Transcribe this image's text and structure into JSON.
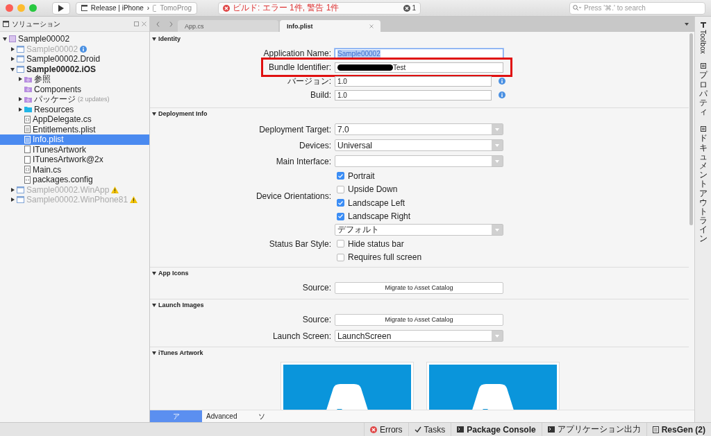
{
  "toolbar": {
    "config": "Release | iPhone",
    "separator": "›",
    "device": "TomoProg",
    "status": "ビルド: エラー 1件, 警告 1件",
    "error_count": "1",
    "search": {
      "placeholder": "Press '⌘.' to search"
    }
  },
  "solution_pad": {
    "title": "ソリューション",
    "tree": [
      {
        "label": "Sample00002",
        "kind": "solution",
        "expanded": true,
        "dimmed": false,
        "selected": false,
        "children": [
          {
            "label": "Sample00002",
            "kind": "project",
            "expanded": false,
            "dimmed": true,
            "selected": false,
            "info": true,
            "warning": false
          },
          {
            "label": "Sample00002.Droid",
            "kind": "project",
            "expanded": false,
            "dimmed": false,
            "selected": false,
            "info": false,
            "warning": false
          },
          {
            "label": "Sample00002.iOS",
            "kind": "project",
            "expanded": true,
            "dimmed": false,
            "selected": false,
            "bold": true,
            "info": false,
            "warning": false,
            "children": [
              {
                "label": "参照",
                "kind": "special-folder",
                "expanded": false,
                "dimmed": false,
                "selected": false
              },
              {
                "label": "Components",
                "kind": "special-folder",
                "dimmed": false,
                "selected": false
              },
              {
                "label": "パッケージ",
                "note": "(2 updates)",
                "kind": "special-folder",
                "expanded": false,
                "dimmed": false,
                "selected": false
              },
              {
                "label": "Resources",
                "kind": "folder",
                "expanded": false,
                "dimmed": false,
                "selected": false
              },
              {
                "label": "AppDelegate.cs",
                "kind": "code",
                "dimmed": false,
                "selected": false
              },
              {
                "label": "Entitlements.plist",
                "kind": "plist",
                "dimmed": false,
                "selected": false
              },
              {
                "label": "Info.plist",
                "kind": "plist",
                "dimmed": false,
                "selected": true
              },
              {
                "label": "ITunesArtwork",
                "kind": "blank",
                "dimmed": false,
                "selected": false
              },
              {
                "label": "ITunesArtwork@2x",
                "kind": "blank",
                "dimmed": false,
                "selected": false
              },
              {
                "label": "Main.cs",
                "kind": "code",
                "dimmed": false,
                "selected": false
              },
              {
                "label": "packages.config",
                "kind": "config",
                "dimmed": false,
                "selected": false
              }
            ]
          },
          {
            "label": "Sample00002.WinApp",
            "kind": "project",
            "expanded": false,
            "dimmed": true,
            "selected": false,
            "info": false,
            "warning": true
          },
          {
            "label": "Sample00002.WinPhone81",
            "kind": "project",
            "expanded": false,
            "dimmed": true,
            "selected": false,
            "info": false,
            "warning": true
          }
        ]
      }
    ]
  },
  "editor_tabs": [
    {
      "label": "App.cs",
      "selected": false
    },
    {
      "label": "Info.plist",
      "selected": true
    }
  ],
  "sections": [
    {
      "title": "Identity",
      "expanded": true,
      "rows": [
        {
          "kind": "text",
          "label": "Application Name:",
          "value": "Sample00002",
          "focused": true,
          "highlighted": false
        },
        {
          "kind": "text",
          "label": "Bundle Identifier:",
          "value": "Test",
          "redacted": true,
          "focused": false,
          "highlighted": true
        },
        {
          "kind": "text",
          "label": "バージョン:",
          "value": "1.0",
          "info": true,
          "focused": false,
          "highlighted": false
        },
        {
          "kind": "text",
          "label": "Build:",
          "value": "1.0",
          "info": true,
          "focused": false,
          "highlighted": false
        }
      ]
    },
    {
      "title": "Deployment Info",
      "expanded": true,
      "rows": [
        {
          "kind": "select",
          "label": "Deployment Target:",
          "value": "7.0"
        },
        {
          "kind": "select",
          "label": "Devices:",
          "value": "Universal"
        },
        {
          "kind": "select",
          "label": "Main Interface:"
        },
        {
          "kind": "checks",
          "label": "Device Orientations:",
          "options": [
            {
              "label": "Portrait",
              "checked": true
            },
            {
              "label": "Upside Down",
              "checked": false
            },
            {
              "label": "Landscape Left",
              "checked": true
            },
            {
              "label": "Landscape Right",
              "checked": true
            }
          ]
        },
        {
          "kind": "checks",
          "label": "Status Bar Style:",
          "value": "デフォルト",
          "options": [
            {
              "label": "Hide status bar",
              "checked": false
            },
            {
              "label": "Requires full screen",
              "checked": false
            }
          ]
        }
      ]
    },
    {
      "title": "App Icons",
      "expanded": true,
      "rows": [
        {
          "kind": "button",
          "label": "Source:",
          "button": "Migrate to Asset Catalog"
        }
      ]
    },
    {
      "title": "Launch Images",
      "expanded": true,
      "rows": [
        {
          "kind": "button",
          "label": "Source:",
          "button": "Migrate to Asset Catalog"
        },
        {
          "kind": "select",
          "label": "Launch Screen:",
          "value": "LaunchScreen"
        }
      ]
    },
    {
      "title": "iTunes Artwork",
      "expanded": true,
      "rows": [
        {
          "kind": "artwork",
          "images": [
            {
              "kind": "logo"
            },
            {
              "kind": "logo"
            }
          ]
        }
      ]
    }
  ],
  "bottom_tabs": [
    {
      "label": "ア",
      "selected": true
    },
    {
      "label": "Advanced",
      "selected": false
    },
    {
      "label": "ソ",
      "selected": false
    }
  ],
  "side_pads": [
    {
      "label": "Toolbox",
      "kind": "rotated"
    },
    {
      "label": "プロパティ",
      "kind": "stacked"
    },
    {
      "label": "ドキュメントアウトライン",
      "kind": "stacked"
    }
  ],
  "status_bar": [
    {
      "label": "Errors",
      "kind": "errors",
      "bold": false
    },
    {
      "label": "Tasks",
      "kind": "tasks",
      "bold": false
    },
    {
      "label": "Package Console",
      "kind": "console",
      "bold": true
    },
    {
      "label": "アプリケーション出力",
      "kind": "console",
      "bold": false
    },
    {
      "label": "ResGen (2)",
      "kind": "document",
      "bold": true
    }
  ]
}
